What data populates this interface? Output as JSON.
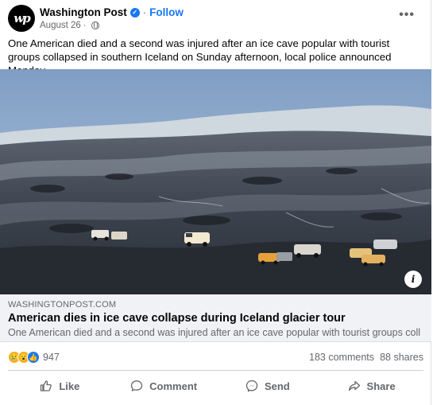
{
  "post": {
    "page_name": "Washington Post",
    "follow_label": "Follow",
    "date": "August 26",
    "text": "One American died and a second was injured after an ice cave popular with tourist groups collapsed in southern Iceland on Sunday afternoon, local police announced Monday.",
    "avatar_text": "wp"
  },
  "link": {
    "domain": "WASHINGTONPOST.COM",
    "title": "American dies in ice cave collapse during Iceland glacier tour",
    "description": "One American died and a second was injured after an ice cave popular with tourist groups coll..."
  },
  "stats": {
    "reactions": "947",
    "comments": "183 comments",
    "shares": "88 shares"
  },
  "actions": {
    "like": "Like",
    "comment": "Comment",
    "send": "Send",
    "share": "Share"
  },
  "colors": {
    "accent": "#1877f2",
    "secondary_text": "#65676b",
    "link_background": "#f0f2f5"
  }
}
